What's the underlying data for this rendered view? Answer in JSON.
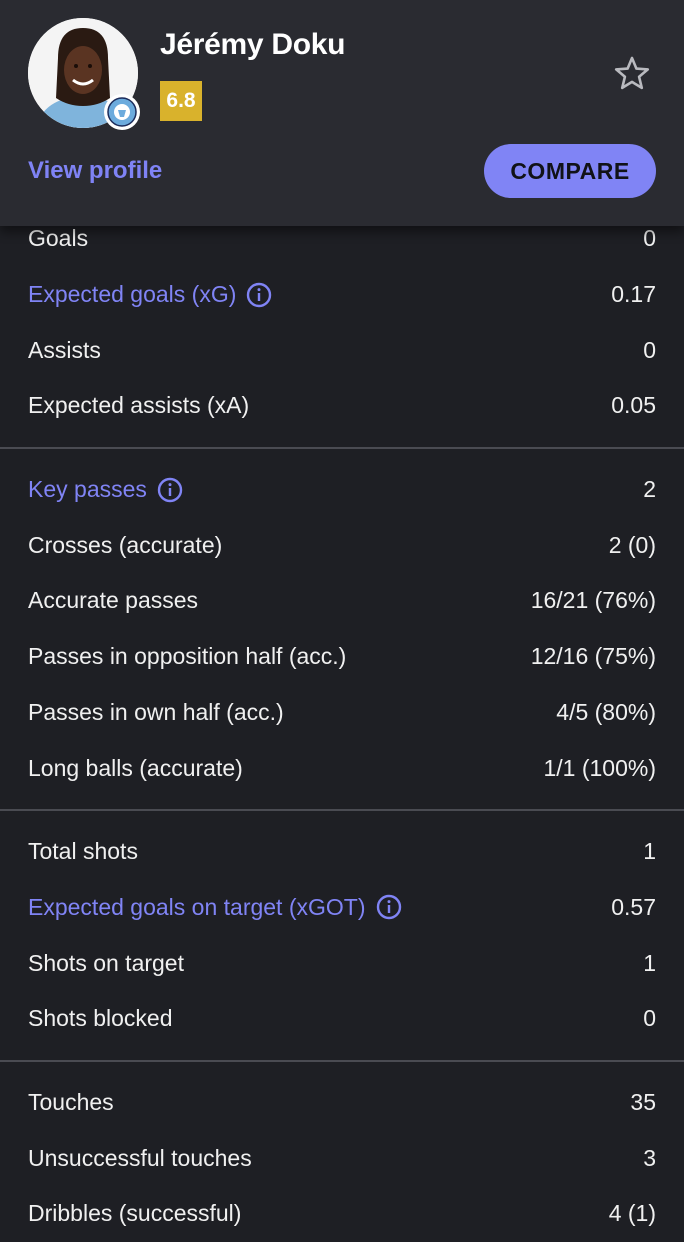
{
  "player": {
    "name": "Jérémy Doku",
    "rating": "6.8",
    "view_profile_label": "View profile",
    "compare_label": "COMPARE"
  },
  "colors": {
    "accent": "#8084f5",
    "rating_bg": "#d9b22c",
    "background": "#1e1f24",
    "header_bg": "#2a2b31"
  },
  "icons": {
    "favorite": "star-outline-icon",
    "info": "info-circle-icon",
    "club": "manchester-city-crest-icon"
  },
  "stat_groups": [
    [
      {
        "label": "Goals",
        "value": "0",
        "link": false
      },
      {
        "label": "Expected goals (xG)",
        "value": "0.17",
        "link": true
      },
      {
        "label": "Assists",
        "value": "0",
        "link": false
      },
      {
        "label": "Expected assists (xA)",
        "value": "0.05",
        "link": false
      }
    ],
    [
      {
        "label": "Key passes",
        "value": "2",
        "link": true
      },
      {
        "label": "Crosses (accurate)",
        "value": "2 (0)",
        "link": false
      },
      {
        "label": "Accurate passes",
        "value": "16/21 (76%)",
        "link": false
      },
      {
        "label": "Passes in opposition half (acc.)",
        "value": "12/16 (75%)",
        "link": false
      },
      {
        "label": "Passes in own half (acc.)",
        "value": "4/5 (80%)",
        "link": false
      },
      {
        "label": "Long balls (accurate)",
        "value": "1/1 (100%)",
        "link": false
      }
    ],
    [
      {
        "label": "Total shots",
        "value": "1",
        "link": false
      },
      {
        "label": "Expected goals on target (xGOT)",
        "value": "0.57",
        "link": true
      },
      {
        "label": "Shots on target",
        "value": "1",
        "link": false
      },
      {
        "label": "Shots blocked",
        "value": "0",
        "link": false
      }
    ],
    [
      {
        "label": "Touches",
        "value": "35",
        "link": false
      },
      {
        "label": "Unsuccessful touches",
        "value": "3",
        "link": false
      },
      {
        "label": "Dribbles (successful)",
        "value": "4 (1)",
        "link": false
      }
    ]
  ]
}
